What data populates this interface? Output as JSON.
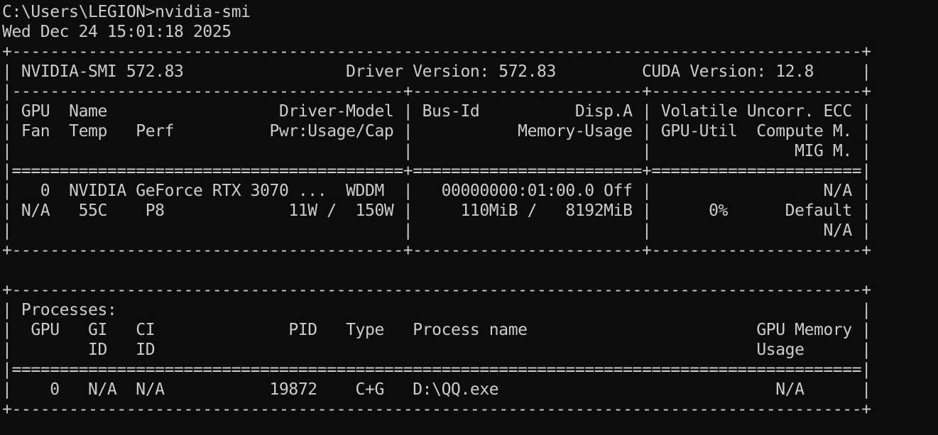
{
  "terminal": {
    "lines": [
      "C:\\Users\\LEGION>nvidia-smi",
      "Wed Dec 24 15:01:18 2025",
      "+-----------------------------------------------------------------------------------------+",
      "| NVIDIA-SMI 572.83                 Driver Version: 572.83         CUDA Version: 12.8     |",
      "|-----------------------------------------+------------------------+----------------------+",
      "| GPU  Name                  Driver-Model | Bus-Id          Disp.A | Volatile Uncorr. ECC |",
      "| Fan  Temp   Perf          Pwr:Usage/Cap |           Memory-Usage | GPU-Util  Compute M. |",
      "|                                         |                        |               MIG M. |",
      "|=========================================+========================+======================|",
      "|   0  NVIDIA GeForce RTX 3070 ...  WDDM  |   00000000:01:00.0 Off |                  N/A |",
      "| N/A   55C    P8             11W /  150W |     110MiB /   8192MiB |      0%      Default |",
      "|                                         |                        |                  N/A |",
      "+-----------------------------------------+------------------------+----------------------+",
      "",
      "+-----------------------------------------------------------------------------------------+",
      "| Processes:                                                                              |",
      "|  GPU   GI   CI              PID   Type   Process name                        GPU Memory |",
      "|        ID   ID                                                               Usage      |",
      "|=========================================================================================|",
      "|    0   N/A  N/A           19872    C+G   D:\\QQ.exe                             N/A      |",
      "+-----------------------------------------------------------------------------------------+"
    ]
  }
}
